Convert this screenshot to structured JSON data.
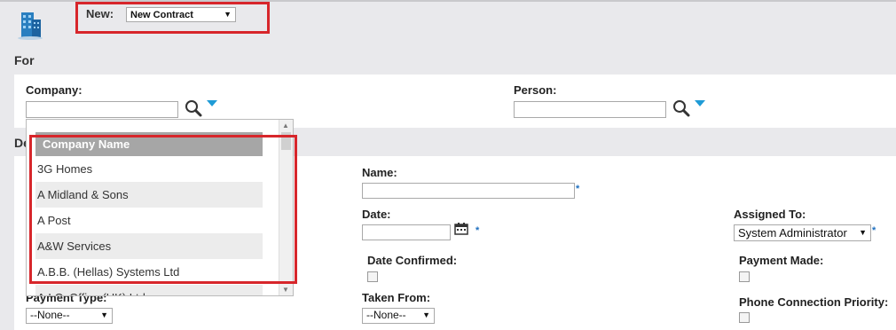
{
  "header": {
    "new_label": "New:",
    "new_select_value": "New Contract"
  },
  "for_section": {
    "title": "For",
    "company_label": "Company:",
    "person_label": "Person:"
  },
  "details_section": {
    "title": "De"
  },
  "form": {
    "name_label": "Name:",
    "date_label": "Date:",
    "assigned_to_label": "Assigned To:",
    "assigned_to_value": "System Administrator",
    "date_confirmed_label": "Date Confirmed:",
    "payment_made_label": "Payment Made:",
    "payment_type_label": "Payment Type:",
    "payment_type_value": "--None--",
    "taken_from_label": "Taken From:",
    "taken_from_value": "--None--",
    "phone_priority_label": "Phone Connection Priority:",
    "required_mark": "*"
  },
  "company_dropdown": {
    "header": "Company Name",
    "items": [
      "3G Homes",
      "A Midland & Sons",
      "A Post",
      "A&W Services",
      "A.B.B. (Hellas) Systems Ltd",
      "A.I.C. Office (UK) Ltd"
    ]
  },
  "colors": {
    "highlight_border": "#d7262b",
    "accent_triangle": "#1f9bd6"
  },
  "icons": {
    "app": "building-icon",
    "search": "magnifier-icon",
    "calendar": "calendar-icon"
  }
}
